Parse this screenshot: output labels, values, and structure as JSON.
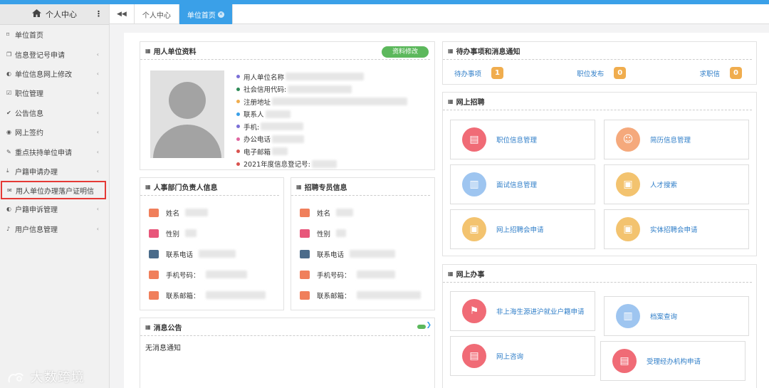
{
  "sidebar": {
    "title": "个人中心",
    "items": [
      {
        "label": "单位首页",
        "icon": "bookmark-icon",
        "arrow": false
      },
      {
        "label": "信息登记号申请",
        "icon": "copy-icon",
        "arrow": true
      },
      {
        "label": "单位信息网上修改",
        "icon": "contrast-icon",
        "arrow": true
      },
      {
        "label": "职位管理",
        "icon": "checkbox-icon",
        "arrow": true
      },
      {
        "label": "公告信息",
        "icon": "check-icon",
        "arrow": true
      },
      {
        "label": "网上签约",
        "icon": "eye-icon",
        "arrow": true
      },
      {
        "label": "重点扶持单位申请",
        "icon": "wrench-icon",
        "arrow": true
      },
      {
        "label": "户籍申请办理",
        "icon": "download-icon",
        "arrow": true
      },
      {
        "label": "用人单位办理落户证明信",
        "icon": "envelope-icon",
        "arrow": false,
        "highlighted": true
      },
      {
        "label": "户籍申诉管理",
        "icon": "contrast-icon",
        "arrow": true
      },
      {
        "label": "用户信息管理",
        "icon": "bell-icon",
        "arrow": true
      }
    ],
    "watermark": "大数跨境"
  },
  "tabs": [
    {
      "label": "个人中心",
      "active": false
    },
    {
      "label": "单位首页",
      "active": true
    }
  ],
  "unit_info": {
    "title": "用人单位资料",
    "edit_button": "资料修改",
    "fields": [
      {
        "label": "用人单位名称",
        "color": "#7b6fd6"
      },
      {
        "label": "社会信用代码:",
        "color": "#2e8b57"
      },
      {
        "label": "注册地址",
        "color": "#f0ad4e"
      },
      {
        "label": "联系人",
        "color": "#3aa0e8"
      },
      {
        "label": "手机:",
        "color": "#7b6fd6"
      },
      {
        "label": "办公电话",
        "color": "#e066a0"
      },
      {
        "label": "电子邮箱",
        "color": "#d9534f"
      },
      {
        "label": "2021年度信息登记号:",
        "color": "#d9534f"
      }
    ]
  },
  "hr_contact": {
    "title": "人事部门负责人信息",
    "fields": [
      {
        "label": "姓名",
        "color": "#f07f5b"
      },
      {
        "label": "性别",
        "color": "#e8567a"
      },
      {
        "label": "联系电话",
        "color": "#4a6b8a"
      },
      {
        "label": "手机号码：",
        "color": "#f07f5b"
      },
      {
        "label": "联系邮箱：",
        "color": "#f07f5b"
      }
    ]
  },
  "recruiter": {
    "title": "招聘专员信息",
    "fields": [
      {
        "label": "姓名",
        "color": "#f07f5b"
      },
      {
        "label": "性别",
        "color": "#e8567a"
      },
      {
        "label": "联系电话",
        "color": "#4a6b8a"
      },
      {
        "label": "手机号码：",
        "color": "#f07f5b"
      },
      {
        "label": "联系邮箱：",
        "color": "#f07f5b"
      }
    ]
  },
  "notices": {
    "title": "消息公告",
    "empty_text": "无消息通知"
  },
  "todo": {
    "title": "待办事项和消息通知",
    "items": [
      {
        "label": "待办事项",
        "count": "1"
      },
      {
        "label": "职位发布",
        "count": "0"
      },
      {
        "label": "求职信",
        "count": "0"
      }
    ]
  },
  "recruit": {
    "title": "网上招聘",
    "cards": [
      {
        "label": "职位信息管理",
        "icon": "clipboard-icon",
        "color": "red"
      },
      {
        "label": "简历信息管理",
        "icon": "users-icon",
        "color": "orange"
      },
      {
        "label": "面试信息管理",
        "icon": "bars-icon",
        "color": "blue"
      },
      {
        "label": "人才搜索",
        "icon": "image-icon",
        "color": "yellow"
      },
      {
        "label": "网上招聘会申请",
        "icon": "image-icon",
        "color": "yellow"
      },
      {
        "label": "实体招聘会申请",
        "icon": "image-icon",
        "color": "yellow"
      }
    ]
  },
  "affairs": {
    "title": "网上办事",
    "cards": [
      {
        "label": "非上海生源进沪就业户籍申请",
        "icon": "signpost-icon",
        "color": "red"
      },
      {
        "label": "档案查询",
        "icon": "bars-icon",
        "color": "blue"
      },
      {
        "label": "网上咨询",
        "icon": "clipboard-icon",
        "color": "red"
      },
      {
        "label": "受理经办机构申请",
        "icon": "clipboard-icon",
        "color": "red"
      }
    ]
  }
}
